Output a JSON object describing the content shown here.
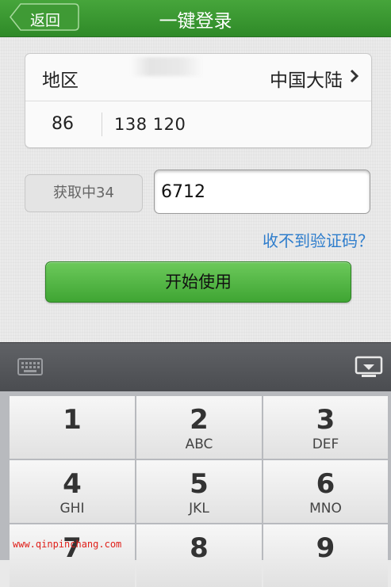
{
  "header": {
    "back_label": "返回",
    "title": "一键登录",
    "color": "#3a9a30"
  },
  "region": {
    "label": "地区",
    "value": "中国大陆"
  },
  "phone": {
    "country_code": "86",
    "number": "138 120"
  },
  "verification": {
    "countdown_label": "获取中34",
    "code_value": "6712"
  },
  "help_link": "收不到验证码？",
  "start_button": "开始使用",
  "keyboard": {
    "keys": [
      {
        "digit": "1",
        "letters": ""
      },
      {
        "digit": "2",
        "letters": "ABC"
      },
      {
        "digit": "3",
        "letters": "DEF"
      },
      {
        "digit": "4",
        "letters": "GHI"
      },
      {
        "digit": "5",
        "letters": "JKL"
      },
      {
        "digit": "6",
        "letters": "MNO"
      },
      {
        "digit": "7",
        "letters": ""
      },
      {
        "digit": "8",
        "letters": ""
      },
      {
        "digit": "9",
        "letters": ""
      }
    ]
  },
  "watermark": "www.qinpinchang.com",
  "icons": {
    "back": "back-arrow-icon",
    "chevron": "chevron-right-icon",
    "keyboard": "keyboard-icon",
    "hide": "hide-keyboard-icon"
  }
}
